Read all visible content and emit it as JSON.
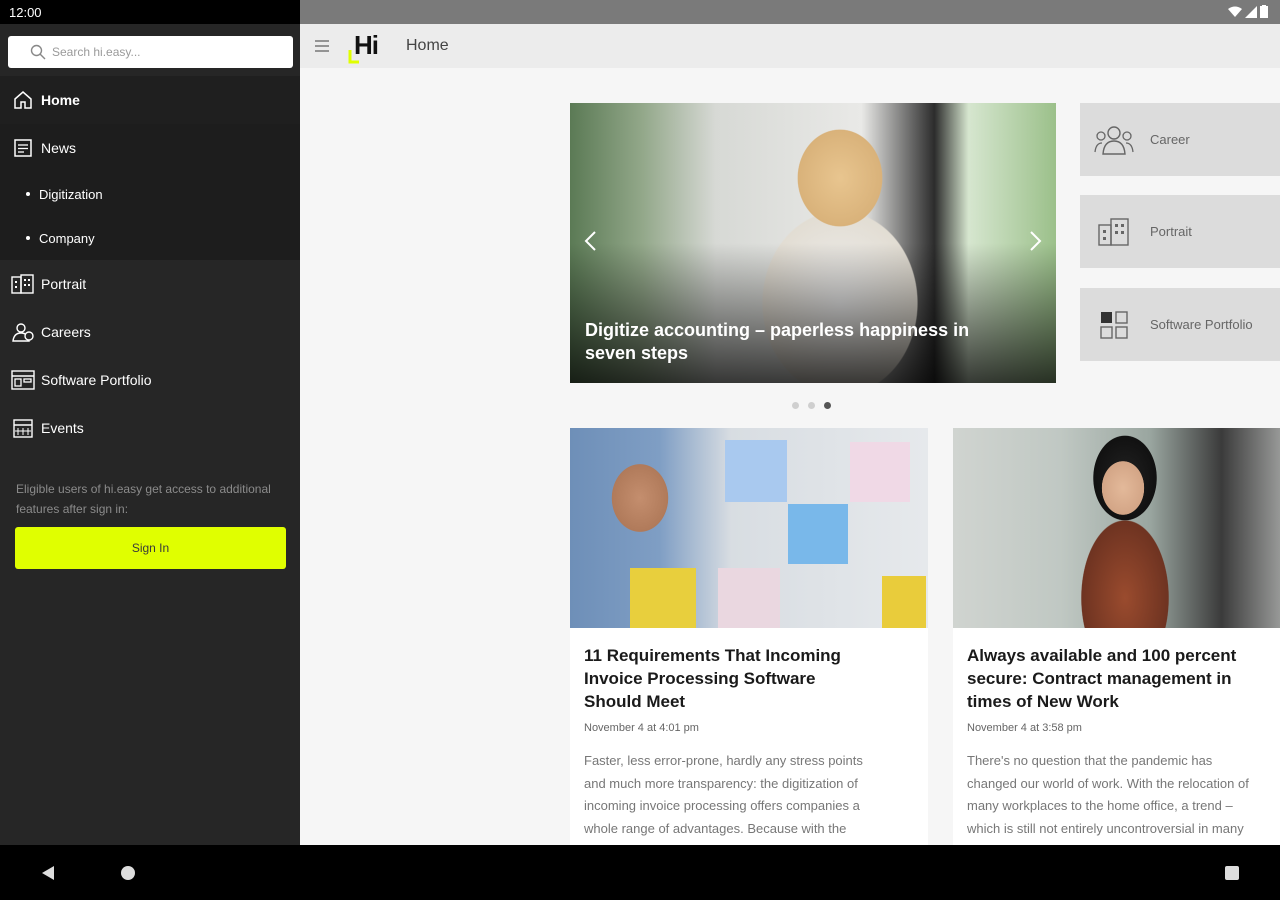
{
  "status_bar": {
    "time": "12:00"
  },
  "sidebar": {
    "search_placeholder": "Search hi.easy...",
    "items": [
      {
        "label": "Home",
        "icon": "home-icon",
        "active": true
      },
      {
        "label": "News",
        "icon": "news-icon"
      },
      {
        "label": "Portrait",
        "icon": "building-icon"
      },
      {
        "label": "Careers",
        "icon": "people-icon"
      },
      {
        "label": "Software Portfolio",
        "icon": "portfolio-icon"
      },
      {
        "label": "Events",
        "icon": "calendar-icon"
      }
    ],
    "news_sub": [
      "Digitization",
      "Company"
    ],
    "note": "Eligible users of hi.easy get access to additional features after sign in:",
    "signin_label": "Sign In"
  },
  "appbar": {
    "logo": "Hi",
    "title": "Home"
  },
  "hero": {
    "title": "Digitize accounting – paperless happiness in seven steps",
    "dots": 3,
    "active_dot": 2
  },
  "tiles": [
    {
      "label": "Career",
      "icon": "career-icon"
    },
    {
      "label": "Portrait",
      "icon": "building-icon"
    },
    {
      "label": "Software Portfolio",
      "icon": "software-portfolio-icon"
    }
  ],
  "cards": [
    {
      "title": "11 Requirements That Incoming\nInvoice Processing Software\nShould Meet",
      "date": "November 4 at 4:01 pm",
      "text": "Faster, less error-prone, hardly any stress points\nand much more transparency: the digitization of\nincoming invoice processing offers companies a\nwhole range of advantages. Because with the"
    },
    {
      "title": "Always available and 100 percent\nsecure: Contract management in\ntimes of New Work",
      "date": "November 4 at 3:58 pm",
      "text": "There's no question that the pandemic has\nchanged our world of work. With the relocation of\nmany workplaces to the home office, a trend –\nwhich is still not entirely uncontroversial in many"
    }
  ],
  "colors": {
    "accent": "#e0ff00",
    "sidebar_bg": "#262626",
    "appbar_bg": "#ececec"
  }
}
